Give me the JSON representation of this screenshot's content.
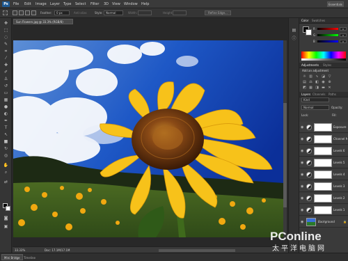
{
  "app": {
    "logo": "Ps"
  },
  "menu": [
    "File",
    "Edit",
    "Image",
    "Layer",
    "Type",
    "Select",
    "Filter",
    "3D",
    "View",
    "Window",
    "Help"
  ],
  "workspace": "Essentials",
  "options": {
    "feather_label": "Feather:",
    "feather_value": "0 px",
    "anti_alias_label": "Anti-alias",
    "style_label": "Style:",
    "style_value": "Normal",
    "width_label": "Width:",
    "height_label": "Height:",
    "refine_edge": "Refine Edge..."
  },
  "document": {
    "tab_title": "Sun Flowers.jpg @ 33.3% (RGB/8)",
    "zoom": "33.33%",
    "doc_size": "Doc: 17.1M/17.1M"
  },
  "bottom_tabs": [
    "Mini Bridge",
    "Timeline"
  ],
  "panels": {
    "color_tab": "Color",
    "swatches_tab": "Swatches",
    "sliders": [
      {
        "label": "R",
        "value": "0",
        "gradient": "linear-gradient(90deg,#000,#f00)"
      },
      {
        "label": "G",
        "value": "0",
        "gradient": "linear-gradient(90deg,#000,#0f0)"
      },
      {
        "label": "B",
        "value": "0",
        "gradient": "linear-gradient(90deg,#000,#00f)"
      }
    ],
    "adjustments_tab": "Adjustments",
    "styles_tab": "Styles",
    "adjustments_title": "Add an adjustment",
    "layers_tab": "Layers",
    "channels_tab": "Channels",
    "paths_tab": "Paths",
    "layer_filter": "Kind",
    "blend_mode": "Normal",
    "opacity": "Opacity:",
    "lock": "Lock:",
    "fill": "Fill:",
    "layers": [
      {
        "name": "Exposure 1"
      },
      {
        "name": "Channel Mixer 1"
      },
      {
        "name": "Levels 6"
      },
      {
        "name": "Levels 5"
      },
      {
        "name": "Levels 4"
      },
      {
        "name": "Levels 3"
      },
      {
        "name": "Levels 2"
      },
      {
        "name": "Levels 1"
      }
    ],
    "background_layer": "Background"
  },
  "watermark": {
    "brand": "PConline",
    "sub": "太平洋电脑网"
  },
  "colors": {
    "accent": "#1e5a94",
    "panel": "#3a3a3a",
    "chrome": "#2b2b2b"
  }
}
